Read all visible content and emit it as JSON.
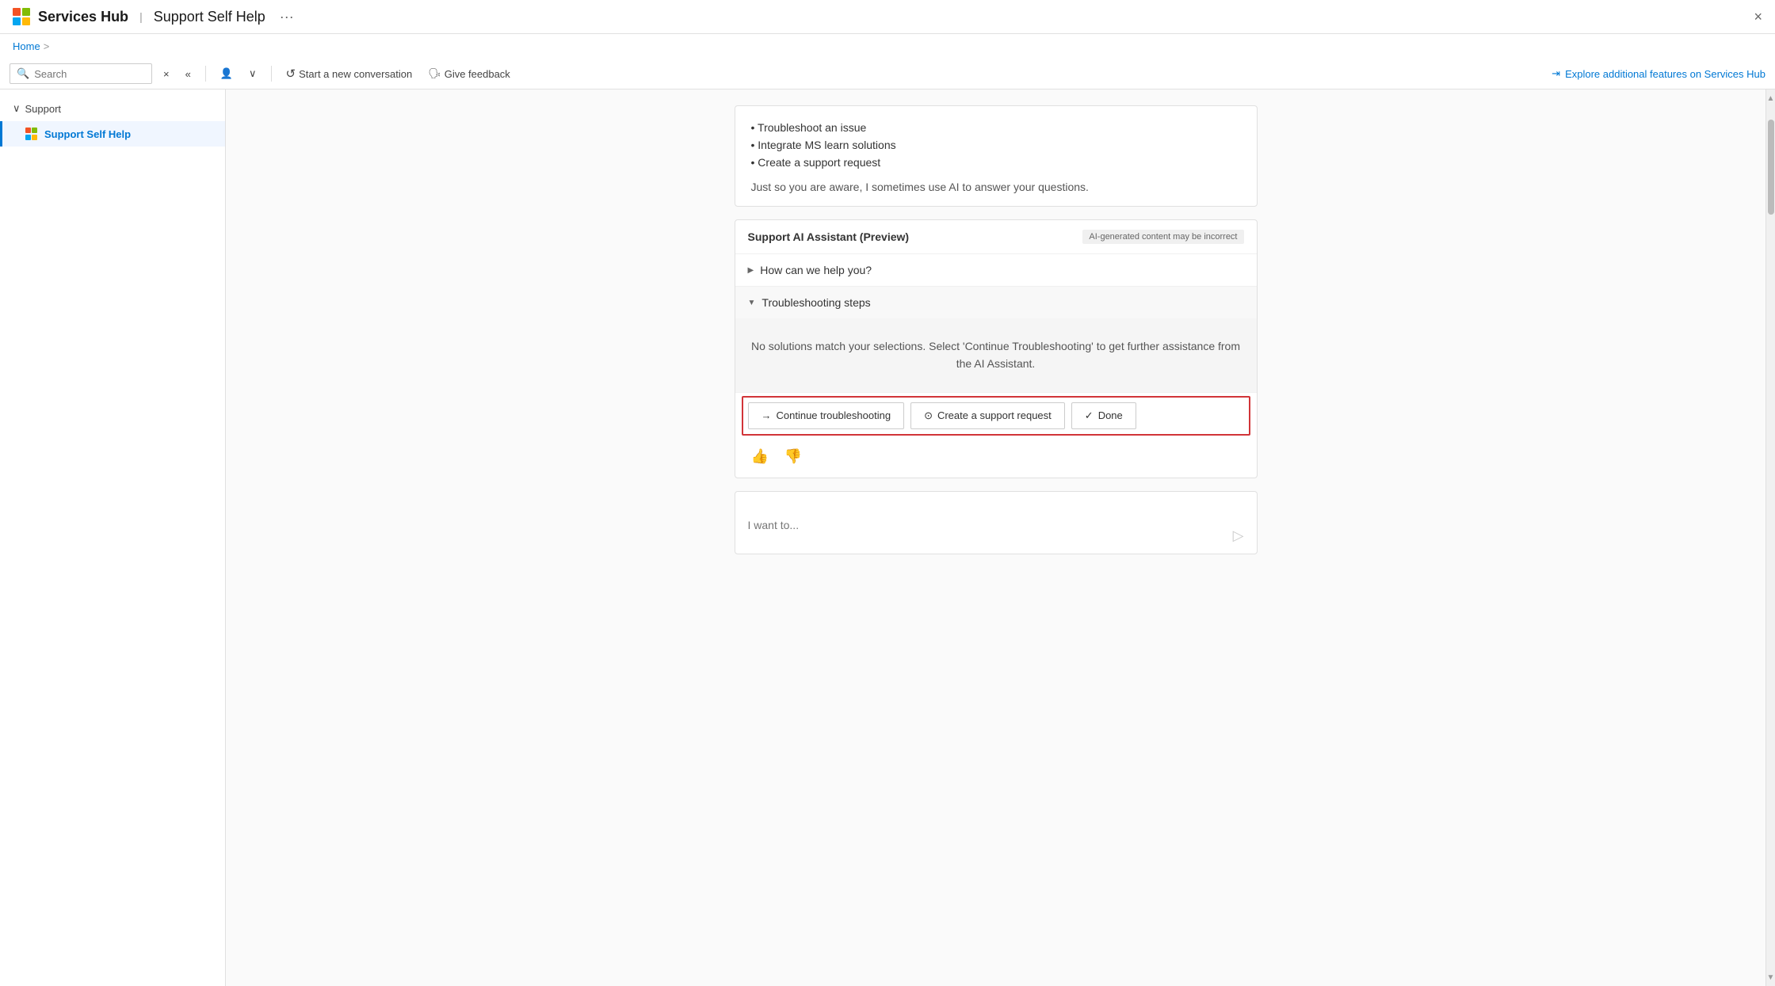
{
  "titlebar": {
    "title": "Services Hub",
    "separator": "|",
    "subtitle": "Support Self Help",
    "dots": "···",
    "close_label": "×"
  },
  "breadcrumb": {
    "home": "Home",
    "chevron": ">"
  },
  "toolbar": {
    "search_placeholder": "Search",
    "clear_label": "×",
    "collapse_label": "«",
    "person_icon": "👤",
    "chevron_down": "∨",
    "start_new_label": "Start a new conversation",
    "give_feedback_label": "Give feedback",
    "explore_label": "Explore additional features on Services Hub"
  },
  "sidebar": {
    "group_label": "Support",
    "items": [
      {
        "label": "Support Self Help",
        "active": true
      }
    ]
  },
  "info_card": {
    "bullets": [
      "Troubleshoot an issue",
      "Integrate MS learn solutions",
      "Create a support request"
    ],
    "note": "Just so you are aware, I sometimes use AI to answer your questions."
  },
  "ai_card": {
    "title": "Support AI Assistant (Preview)",
    "badge": "AI-generated content may be incorrect",
    "section1_label": "How can we help you?",
    "section2_label": "Troubleshooting steps",
    "section2_expanded": true,
    "troubleshooting_msg": "No solutions match your selections. Select 'Continue Troubleshooting' to get further assistance from the AI Assistant.",
    "btn_continue": "Continue troubleshooting",
    "btn_support": "Create a support request",
    "btn_done": "Done",
    "chat_placeholder": "I want to..."
  },
  "icons": {
    "search": "🔍",
    "refresh": "↺",
    "feedback_person": "🗣",
    "explore": "⇥",
    "arrow_right": "→",
    "support_icon": "⊙",
    "check": "✓",
    "thumbs_up": "👍",
    "thumbs_down": "👎",
    "send": "▷"
  }
}
